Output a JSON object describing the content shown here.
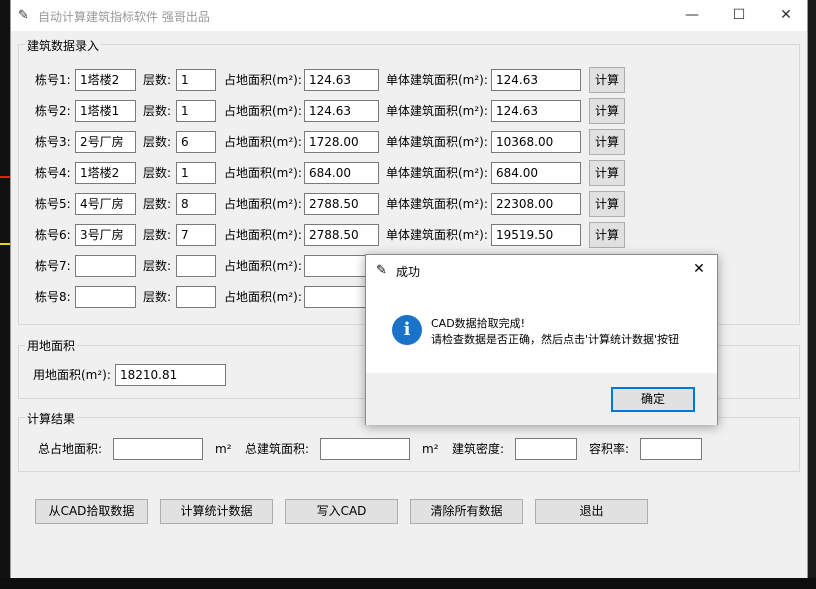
{
  "window": {
    "title": "自动计算建筑指标软件    强哥出品",
    "minimize": "—",
    "maximize": "☐",
    "close": "✕"
  },
  "data_entry": {
    "group_label": "建筑数据录入",
    "rows": [
      {
        "building_label": "栋号1:",
        "building": "1塔楼2",
        "floors_label": "层数:",
        "floors": "1",
        "footprint_label": "占地面积(m²):",
        "footprint": "124.63",
        "area_label": "单体建筑面积(m²):",
        "area": "124.63",
        "calc": "计算"
      },
      {
        "building_label": "栋号2:",
        "building": "1塔楼1",
        "floors_label": "层数:",
        "floors": "1",
        "footprint_label": "占地面积(m²):",
        "footprint": "124.63",
        "area_label": "单体建筑面积(m²):",
        "area": "124.63",
        "calc": "计算"
      },
      {
        "building_label": "栋号3:",
        "building": "2号厂房",
        "floors_label": "层数:",
        "floors": "6",
        "footprint_label": "占地面积(m²):",
        "footprint": "1728.00",
        "area_label": "单体建筑面积(m²):",
        "area": "10368.00",
        "calc": "计算"
      },
      {
        "building_label": "栋号4:",
        "building": "1塔楼2",
        "floors_label": "层数:",
        "floors": "1",
        "footprint_label": "占地面积(m²):",
        "footprint": "684.00",
        "area_label": "单体建筑面积(m²):",
        "area": "684.00",
        "calc": "计算"
      },
      {
        "building_label": "栋号5:",
        "building": "4号厂房",
        "floors_label": "层数:",
        "floors": "8",
        "footprint_label": "占地面积(m²):",
        "footprint": "2788.50",
        "area_label": "单体建筑面积(m²):",
        "area": "22308.00",
        "calc": "计算"
      },
      {
        "building_label": "栋号6:",
        "building": "3号厂房",
        "floors_label": "层数:",
        "floors": "7",
        "footprint_label": "占地面积(m²):",
        "footprint": "2788.50",
        "area_label": "单体建筑面积(m²):",
        "area": "19519.50",
        "calc": "计算"
      },
      {
        "building_label": "栋号7:",
        "building": "",
        "floors_label": "层数:",
        "floors": "",
        "footprint_label": "占地面积(m²):",
        "footprint": ""
      },
      {
        "building_label": "栋号8:",
        "building": "",
        "floors_label": "层数:",
        "floors": "",
        "footprint_label": "占地面积(m²):",
        "footprint": ""
      }
    ]
  },
  "land": {
    "group_label": "用地面积",
    "label": "用地面积(m²):",
    "value": "18210.81"
  },
  "results": {
    "group_label": "计算结果",
    "total_footprint_label": "总占地面积:",
    "total_footprint": "",
    "unit1": "m²",
    "total_area_label": "总建筑面积:",
    "total_area": "",
    "unit2": "m²",
    "density_label": "建筑密度:",
    "density": "",
    "far_label": "容积率:",
    "far": ""
  },
  "buttons": {
    "pick_cad": "从CAD拾取数据",
    "calc_stats": "计算统计数据",
    "write_cad": "写入CAD",
    "clear_all": "清除所有数据",
    "exit": "退出"
  },
  "dialog": {
    "title": "成功",
    "close": "✕",
    "icon": "info-icon",
    "line1": "CAD数据拾取完成!",
    "line2": "请检查数据是否正确，然后点击'计算统计数据'按钮",
    "ok": "确定"
  },
  "colors": {
    "info_icon": "#1a73c8",
    "ok_border": "#0078d7",
    "window_bg": "#f0f0f0"
  }
}
